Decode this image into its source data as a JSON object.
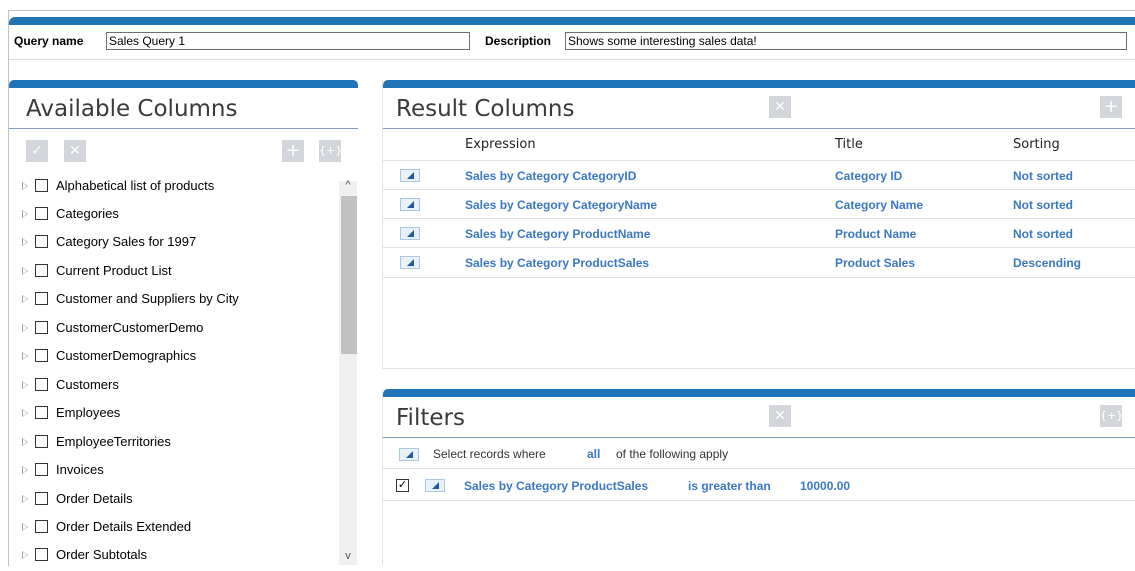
{
  "query": {
    "name_label": "Query name",
    "name_value": "Sales Query 1",
    "description_label": "Description",
    "description_value": "Shows some interesting sales data!"
  },
  "available": {
    "title": "Available Columns",
    "toolbar": {
      "check": "✓",
      "remove": "✕",
      "add": "+",
      "add_expression": "{+}"
    },
    "items": [
      {
        "label": "Alphabetical list of products"
      },
      {
        "label": "Categories"
      },
      {
        "label": "Category Sales for 1997"
      },
      {
        "label": "Current Product List"
      },
      {
        "label": "Customer and Suppliers by City"
      },
      {
        "label": "CustomerCustomerDemo"
      },
      {
        "label": "CustomerDemographics"
      },
      {
        "label": "Customers"
      },
      {
        "label": "Employees"
      },
      {
        "label": "EmployeeTerritories"
      },
      {
        "label": "Invoices"
      },
      {
        "label": "Order Details"
      },
      {
        "label": "Order Details Extended"
      },
      {
        "label": "Order Subtotals"
      }
    ],
    "scroll_up": "^",
    "scroll_down": "v"
  },
  "result": {
    "title": "Result Columns",
    "remove": "✕",
    "add": "+",
    "headers": {
      "expression": "Expression",
      "title": "Title",
      "sorting": "Sorting"
    },
    "rows": [
      {
        "expression": "Sales by Category CategoryID",
        "title": "Category ID",
        "sorting": "Not sorted"
      },
      {
        "expression": "Sales by Category CategoryName",
        "title": "Category Name",
        "sorting": "Not sorted"
      },
      {
        "expression": "Sales by Category ProductName",
        "title": "Product Name",
        "sorting": "Not sorted"
      },
      {
        "expression": "Sales by Category ProductSales",
        "title": "Product Sales",
        "sorting": "Descending"
      }
    ]
  },
  "filters": {
    "title": "Filters",
    "remove": "✕",
    "add_group": "{+}",
    "intro_prefix": "Select records where",
    "intro_mode": "all",
    "intro_suffix": "of the following apply",
    "condition": {
      "checked": true,
      "check_glyph": "✓",
      "field": "Sales by Category ProductSales",
      "operator": "is greater than",
      "value": "10000.00"
    }
  }
}
